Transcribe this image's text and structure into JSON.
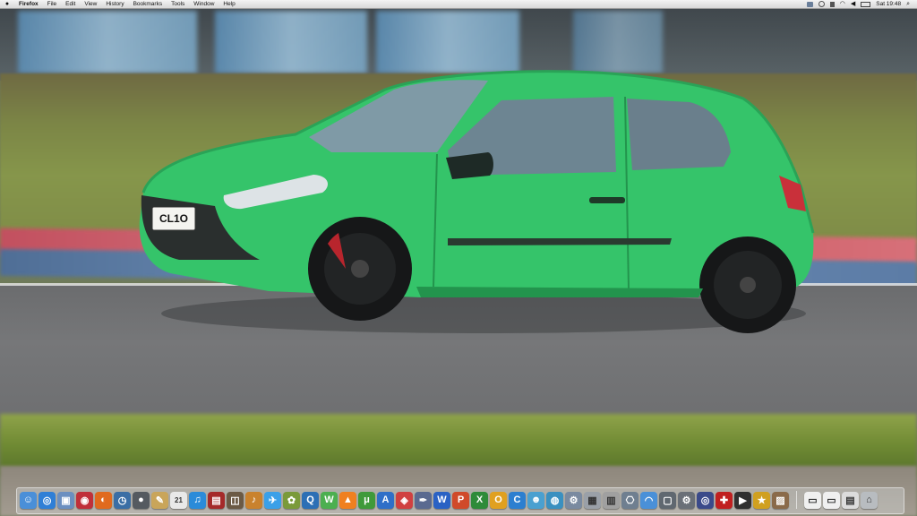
{
  "menubar": {
    "app_name": "Firefox",
    "menus": [
      "File",
      "Edit",
      "View",
      "History",
      "Bookmarks",
      "Tools",
      "Window",
      "Help"
    ],
    "clock": "Sat 19:48"
  },
  "wallpaper": {
    "number_plate": "CL1O"
  },
  "dock": {
    "apps": [
      {
        "icon": "finder-icon",
        "color": "#4a8fd8",
        "glyph": "☺"
      },
      {
        "icon": "safari-icon",
        "color": "#2f7fd6",
        "glyph": "◎"
      },
      {
        "icon": "preview-icon",
        "color": "#6b8fc0",
        "glyph": "▣"
      },
      {
        "icon": "photo-booth-icon",
        "color": "#c0303a",
        "glyph": "◉"
      },
      {
        "icon": "firefox-icon",
        "color": "#e06a1e",
        "glyph": "◐"
      },
      {
        "icon": "time-machine-icon",
        "color": "#3b6ea5",
        "glyph": "◷"
      },
      {
        "icon": "camera-icon",
        "color": "#555a60",
        "glyph": "●"
      },
      {
        "icon": "notes-icon",
        "color": "#c9a55a",
        "glyph": "✎"
      },
      {
        "icon": "calendar-icon",
        "color": "#e9e9e9",
        "glyph": "21"
      },
      {
        "icon": "itunes-icon",
        "color": "#2b8bd9",
        "glyph": "♫"
      },
      {
        "icon": "photo-icon",
        "color": "#a52a2a",
        "glyph": "▤"
      },
      {
        "icon": "iphoto-icon",
        "color": "#6b5a45",
        "glyph": "◫"
      },
      {
        "icon": "garageband-icon",
        "color": "#c9822d",
        "glyph": "♪"
      },
      {
        "icon": "twitter-icon",
        "color": "#3aa0e8",
        "glyph": "✈"
      },
      {
        "icon": "app-icon",
        "color": "#7a9a3a",
        "glyph": "✿"
      },
      {
        "icon": "quicktime-icon",
        "color": "#2c6fb5",
        "glyph": "Q"
      },
      {
        "icon": "wmv-icon",
        "color": "#4caf50",
        "glyph": "W"
      },
      {
        "icon": "vlc-icon",
        "color": "#f08020",
        "glyph": "▲"
      },
      {
        "icon": "utorrent-icon",
        "color": "#3f9a3a",
        "glyph": "μ"
      },
      {
        "icon": "app-store-icon",
        "color": "#2f6fc8",
        "glyph": "A"
      },
      {
        "icon": "dashboard-icon",
        "color": "#d04040",
        "glyph": "◈"
      },
      {
        "icon": "script-editor-icon",
        "color": "#5a6a90",
        "glyph": "✒"
      },
      {
        "icon": "word-icon",
        "color": "#2a62c4",
        "glyph": "W"
      },
      {
        "icon": "powerpoint-icon",
        "color": "#d04a2a",
        "glyph": "P"
      },
      {
        "icon": "excel-icon",
        "color": "#2e8b3a",
        "glyph": "X"
      },
      {
        "icon": "outlook-icon",
        "color": "#e0a020",
        "glyph": "O"
      },
      {
        "icon": "communicator-icon",
        "color": "#2c7fd0",
        "glyph": "C"
      },
      {
        "icon": "messenger-icon",
        "color": "#4aa0d0",
        "glyph": "☻"
      },
      {
        "icon": "globe-icon",
        "color": "#3a90c0",
        "glyph": "◍"
      },
      {
        "icon": "migration-icon",
        "color": "#7a8aa0",
        "glyph": "⚙"
      },
      {
        "icon": "screenshot-icon",
        "color": "#9aa0a8",
        "glyph": "▦"
      },
      {
        "icon": "calculator-icon",
        "color": "#a0a0a0",
        "glyph": "▥"
      },
      {
        "icon": "disk-utility-icon",
        "color": "#6f7f90",
        "glyph": "⎔"
      },
      {
        "icon": "wifi-icon",
        "color": "#4a90d8",
        "glyph": "◠"
      },
      {
        "icon": "console-icon",
        "color": "#606870",
        "glyph": "▢"
      },
      {
        "icon": "system-preferences-icon",
        "color": "#6a7078",
        "glyph": "⚙"
      },
      {
        "icon": "network-icon",
        "color": "#3a4a8a",
        "glyph": "◎"
      },
      {
        "icon": "activity-icon",
        "color": "#c02020",
        "glyph": "✚"
      },
      {
        "icon": "movie-icon",
        "color": "#303030",
        "glyph": "▶"
      },
      {
        "icon": "star-icon",
        "color": "#d0a020",
        "glyph": "★"
      },
      {
        "icon": "photos-icon",
        "color": "#8a6a4a",
        "glyph": "▨"
      }
    ],
    "stacks": [
      {
        "icon": "document-icon",
        "color": "#f0f0f0",
        "glyph": "▭"
      },
      {
        "icon": "document-icon",
        "color": "#f0f0f0",
        "glyph": "▭"
      },
      {
        "icon": "downloads-stack-icon",
        "color": "#dcdcdc",
        "glyph": "▤"
      },
      {
        "icon": "trash-icon",
        "color": "#b8bcc0",
        "glyph": "⌂"
      }
    ]
  }
}
